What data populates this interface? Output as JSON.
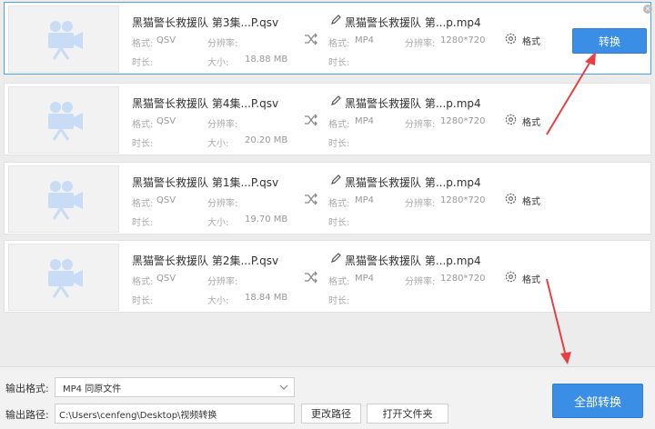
{
  "labels": {
    "format": "格式:",
    "resolution": "分辨率:",
    "duration": "时长:",
    "size": "大小:",
    "settings": "格式"
  },
  "files": [
    {
      "source_name": "黑猫警长救援队 第3集...P.qsv",
      "source_format": "QSV",
      "source_size": "18.88 MB",
      "output_name": "黑猫警长救援队 第...p.mp4",
      "output_format": "MP4",
      "output_resolution": "1280*720",
      "selected": true
    },
    {
      "source_name": "黑猫警长救援队 第4集...P.qsv",
      "source_format": "QSV",
      "source_size": "20.20 MB",
      "output_name": "黑猫警长救援队 第...p.mp4",
      "output_format": "MP4",
      "output_resolution": "1280*720",
      "selected": false
    },
    {
      "source_name": "黑猫警长救援队 第1集...P.qsv",
      "source_format": "QSV",
      "source_size": "19.70 MB",
      "output_name": "黑猫警长救援队 第...p.mp4",
      "output_format": "MP4",
      "output_resolution": "1280*720",
      "selected": false
    },
    {
      "source_name": "黑猫警长救援队 第2集...P.qsv",
      "source_format": "QSV",
      "source_size": "18.84 MB",
      "output_name": "黑猫警长救援队 第...p.mp4",
      "output_format": "MP4",
      "output_resolution": "1280*720",
      "selected": false
    }
  ],
  "convert_label": "转换",
  "bottom": {
    "output_format_label": "输出格式:",
    "output_format_value": "MP4  同原文件",
    "output_path_label": "输出路径:",
    "output_path_value": "C:\\Users\\cenfeng\\Desktop\\视频转换",
    "change_path_label": "更改路径",
    "open_folder_label": "打开文件夹",
    "convert_all_label": "全部转换"
  },
  "colors": {
    "accent": "#3a8ee6",
    "annotation_arrow": "#e84040",
    "thumb_icon": "#c8dcf5"
  },
  "icons": [
    "video-camera-icon",
    "shuffle-icon",
    "pencil-icon",
    "gear-icon",
    "close-icon",
    "chevron-down-icon"
  ]
}
